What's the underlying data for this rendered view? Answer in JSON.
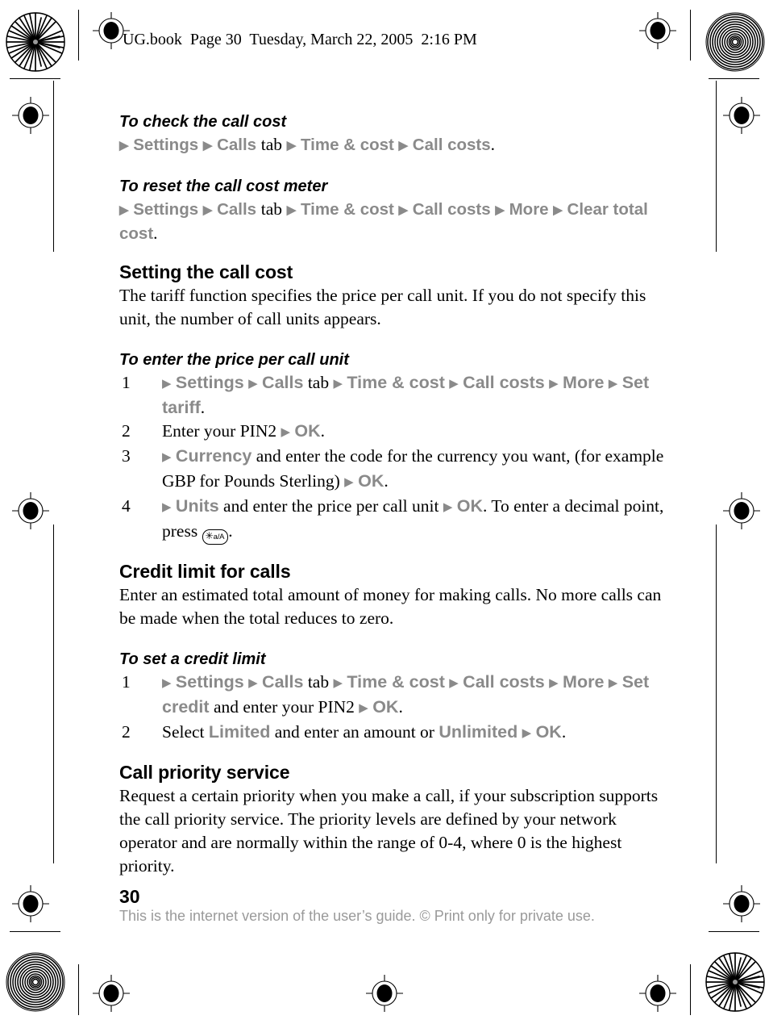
{
  "header": {
    "text": "UG.book  Page 30  Tuesday, March 22, 2005  2:16 PM"
  },
  "arrow": "▶",
  "sections": [
    {
      "id": "check-call-cost",
      "kind": "subheading",
      "heading": "To check the call cost",
      "path": [
        "Settings",
        "Calls",
        "Time & cost",
        "Call costs"
      ],
      "tab_word": "tab"
    },
    {
      "id": "reset-call-cost-meter",
      "kind": "subheading",
      "heading": "To reset the call cost meter",
      "path": [
        "Settings",
        "Calls",
        "Time & cost",
        "Call costs",
        "More",
        "Clear total cost"
      ],
      "tab_word": "tab"
    },
    {
      "id": "setting-the-call-cost",
      "kind": "heading",
      "heading": "Setting the call cost",
      "body": "The tariff function specifies the price per call unit. If you do not specify this unit, the number of call units appears."
    },
    {
      "id": "enter-price-per-call-unit",
      "kind": "subheading",
      "heading": "To enter the price per call unit"
    },
    {
      "id": "credit-limit-for-calls",
      "kind": "heading",
      "heading": "Credit limit for calls",
      "body": "Enter an estimated total amount of money for making calls. No more calls can be made when the total reduces to zero."
    },
    {
      "id": "set-a-credit-limit",
      "kind": "subheading",
      "heading": "To set a credit limit"
    },
    {
      "id": "call-priority-service",
      "kind": "heading",
      "heading": "Call priority service",
      "body": "Request a certain priority when you make a call, if your subscription supports the call priority service. The priority levels are defined by your network operator and are normally within the range of 0-4, where 0 is the highest priority."
    }
  ],
  "price_steps": {
    "n1": "1",
    "n2": "2",
    "n3": "3",
    "n4": "4",
    "s1_settings": "Settings",
    "s1_calls": "Calls",
    "s1_tab": "tab",
    "s1_time": "Time & cost",
    "s1_callcosts": "Call costs",
    "s1_more": "More",
    "s1_settariff": "Set tariff",
    "s1_period": ".",
    "s2_text": "Enter your PIN2",
    "s2_ok": "OK",
    "s2_period": ".",
    "s3_currency": "Currency",
    "s3_text": " and enter the code for the currency you want, (for example GBP for Pounds Sterling) ",
    "s3_ok": "OK",
    "s3_period": ".",
    "s4_units": "Units",
    "s4_text": " and enter the price per call unit ",
    "s4_ok": "OK",
    "s4_text2": ". To enter a decimal point, press ",
    "s4_period": ".",
    "key_star": "✳",
    "key_label": "a/A"
  },
  "credit_steps": {
    "n1": "1",
    "n2": "2",
    "s1_settings": "Settings",
    "s1_calls": "Calls",
    "s1_tab": "tab",
    "s1_time": "Time & cost",
    "s1_callcosts": "Call costs",
    "s1_more": "More",
    "s1_setcredit": "Set credit",
    "s1_text": " and enter your PIN2 ",
    "s1_ok": "OK",
    "s1_period": ".",
    "s2_select": "Select ",
    "s2_limited": "Limited",
    "s2_text": " and enter an amount or ",
    "s2_unlimited": "Unlimited",
    "s2_ok": "OK",
    "s2_period": "."
  },
  "footer": {
    "page_number": "30",
    "disclaimer": "This is the internet version of the user’s guide. © Print only for private use."
  },
  "colors": {
    "menu_gray": "#8a8a8a",
    "footer_gray": "#9a9a9a",
    "text_black": "#000000"
  }
}
